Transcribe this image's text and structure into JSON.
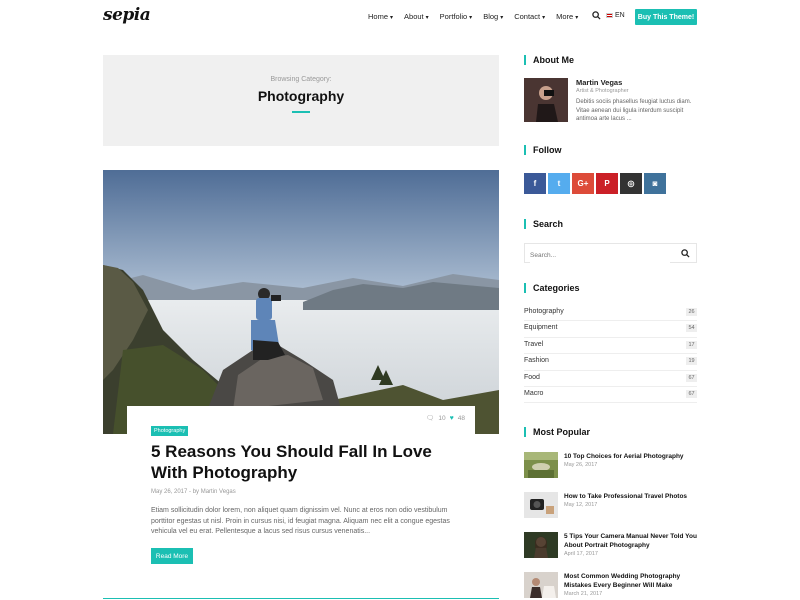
{
  "header": {
    "logo": "sepia",
    "nav": [
      {
        "label": "Home"
      },
      {
        "label": "About"
      },
      {
        "label": "Portfolio"
      },
      {
        "label": "Blog"
      },
      {
        "label": "Contact"
      },
      {
        "label": "More"
      }
    ],
    "lang": "EN",
    "buy_label": "Buy This Theme!"
  },
  "banner": {
    "subtitle": "Browsing Category:",
    "title": "Photography"
  },
  "post": {
    "comments": "10",
    "likes": "48",
    "category": "Photography",
    "title": "5 Reasons You Should Fall In Love With Photography",
    "date": "May 26, 2017",
    "author_prefix": "- by",
    "author": "Martin Vegas",
    "excerpt": "Etiam sollicitudin dolor lorem, non aliquet quam dignissim vel. Nunc at eros non odio vestibulum porttitor egestas ut nisl. Proin in cursus nisi, id feugiat magna. Aliquam nec elit a congue egestas vehicula vel eu erat. Pellentesque a lacus sed risus cursus venenatis...",
    "read_more": "Read More"
  },
  "sidebar": {
    "about": {
      "heading": "About Me",
      "name": "Martin Vegas",
      "role": "Artist & Photographer",
      "text": "Debitis sociis phasellus feugiat luctus diam. Vitae aenean dui ligula interdum suscipit antimoa arte lacus ..."
    },
    "follow": {
      "heading": "Follow",
      "networks": [
        {
          "name": "facebook-icon",
          "glyph": "f",
          "color": "#3b5998"
        },
        {
          "name": "twitter-icon",
          "glyph": "t",
          "color": "#55acee"
        },
        {
          "name": "google-plus-icon",
          "glyph": "G+",
          "color": "#dd4b39"
        },
        {
          "name": "pinterest-icon",
          "glyph": "P",
          "color": "#cb2027"
        },
        {
          "name": "dribbble-icon",
          "glyph": "◎",
          "color": "#333333"
        },
        {
          "name": "instagram-icon",
          "glyph": "◙",
          "color": "#3f729b"
        }
      ]
    },
    "search": {
      "heading": "Search",
      "placeholder": "Search..."
    },
    "categories": {
      "heading": "Categories",
      "items": [
        {
          "name": "Photography",
          "count": "26"
        },
        {
          "name": "Equipment",
          "count": "54"
        },
        {
          "name": "Travel",
          "count": "17"
        },
        {
          "name": "Fashion",
          "count": "19"
        },
        {
          "name": "Food",
          "count": "67"
        },
        {
          "name": "Macro",
          "count": "67"
        }
      ]
    },
    "popular": {
      "heading": "Most Popular",
      "items": [
        {
          "title": "10 Top Choices for Aerial Photography",
          "date": "May 26, 2017"
        },
        {
          "title": "How to Take Professional Travel Photos",
          "date": "May 12, 2017"
        },
        {
          "title": "5 Tips Your Camera Manual Never Told You About Portrait Photography",
          "date": "April 17, 2017"
        },
        {
          "title": "Most Common Wedding Photography Mistakes Every Beginner Will Make",
          "date": "March 21, 2017"
        }
      ]
    }
  },
  "colors": {
    "accent": "#1bbfb3"
  }
}
